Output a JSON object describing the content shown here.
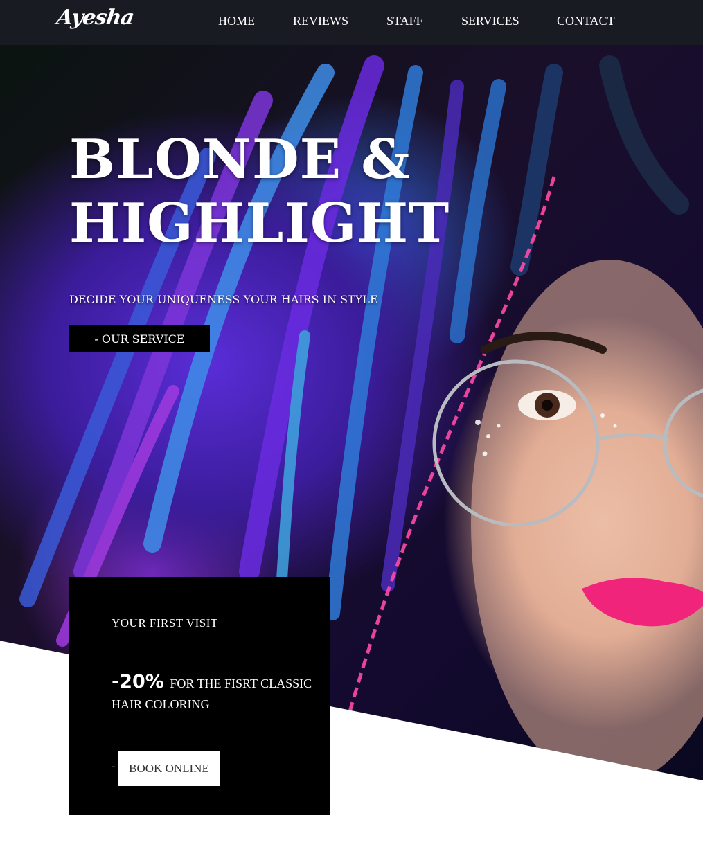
{
  "nav": {
    "logo": "Ayesha",
    "links": [
      "HOME",
      "REVIEWS",
      "STAFF",
      "SERVICES",
      "CONTACT"
    ]
  },
  "hero": {
    "title_line1": "BLONDE &",
    "title_line2": "HIGHLIGHT",
    "subtitle": "DECIDE YOUR UNIQUENESS YOUR HAIRS IN STYLE",
    "service_button": "-  OUR SERVICE"
  },
  "offer": {
    "title": "YOUR FIRST VISIT",
    "discount": "-20%",
    "description": "FOR THE FISRT CLASSIC HAIR COLORING",
    "dash": "-",
    "book_button": "BOOK ONLINE"
  },
  "colors": {
    "nav_bg": "#181b22",
    "box_bg": "#000000",
    "text": "#ffffff"
  }
}
